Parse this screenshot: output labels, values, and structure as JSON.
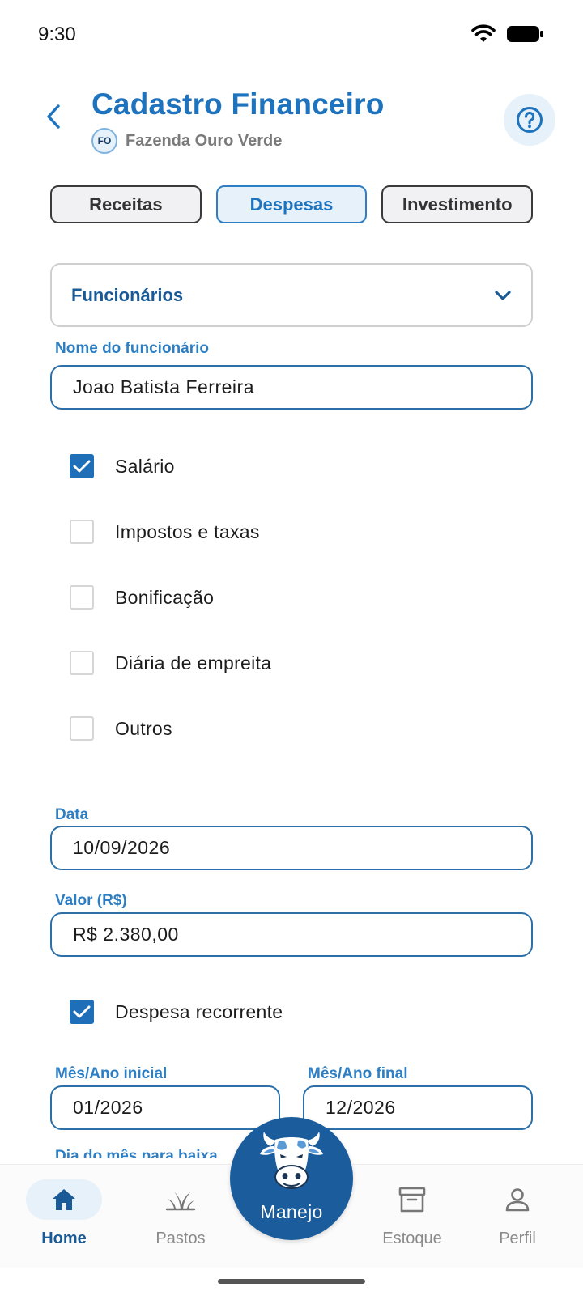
{
  "status_bar": {
    "time": "9:30"
  },
  "header": {
    "title": "Cadastro Financeiro",
    "farm_initials": "FO",
    "farm_name": "Fazenda Ouro Verde"
  },
  "tabs": [
    {
      "label": "Receitas",
      "active": false
    },
    {
      "label": "Despesas",
      "active": true
    },
    {
      "label": "Investimento",
      "active": false
    }
  ],
  "category_select": {
    "value": "Funcionários"
  },
  "employee": {
    "label": "Nome do funcionário",
    "value": "Joao Batista Ferreira"
  },
  "expense_types": [
    {
      "label": "Salário",
      "checked": true
    },
    {
      "label": "Impostos e taxas",
      "checked": false
    },
    {
      "label": "Bonificação",
      "checked": false
    },
    {
      "label": "Diária de empreita",
      "checked": false
    },
    {
      "label": "Outros",
      "checked": false
    }
  ],
  "date": {
    "label": "Data",
    "value": "10/09/2026"
  },
  "amount": {
    "label": "Valor (R$)",
    "value": "R$ 2.380,00"
  },
  "recurring": {
    "label": "Despesa recorrente",
    "checked": true
  },
  "start_month": {
    "label": "Mês/Ano inicial",
    "value": "01/2026"
  },
  "end_month": {
    "label": "Mês/Ano final",
    "value": "12/2026"
  },
  "due_day": {
    "label": "Dia do mês para baixa"
  },
  "bottom_nav": {
    "home": "Home",
    "pastures": "Pastos",
    "manage": "Manejo",
    "stock": "Estoque",
    "profile": "Perfil"
  },
  "colors": {
    "primary": "#1e73be",
    "primary_dark": "#1b5d9c",
    "accent_light": "#e6f1fa",
    "muted_text": "#8a8a8a"
  }
}
